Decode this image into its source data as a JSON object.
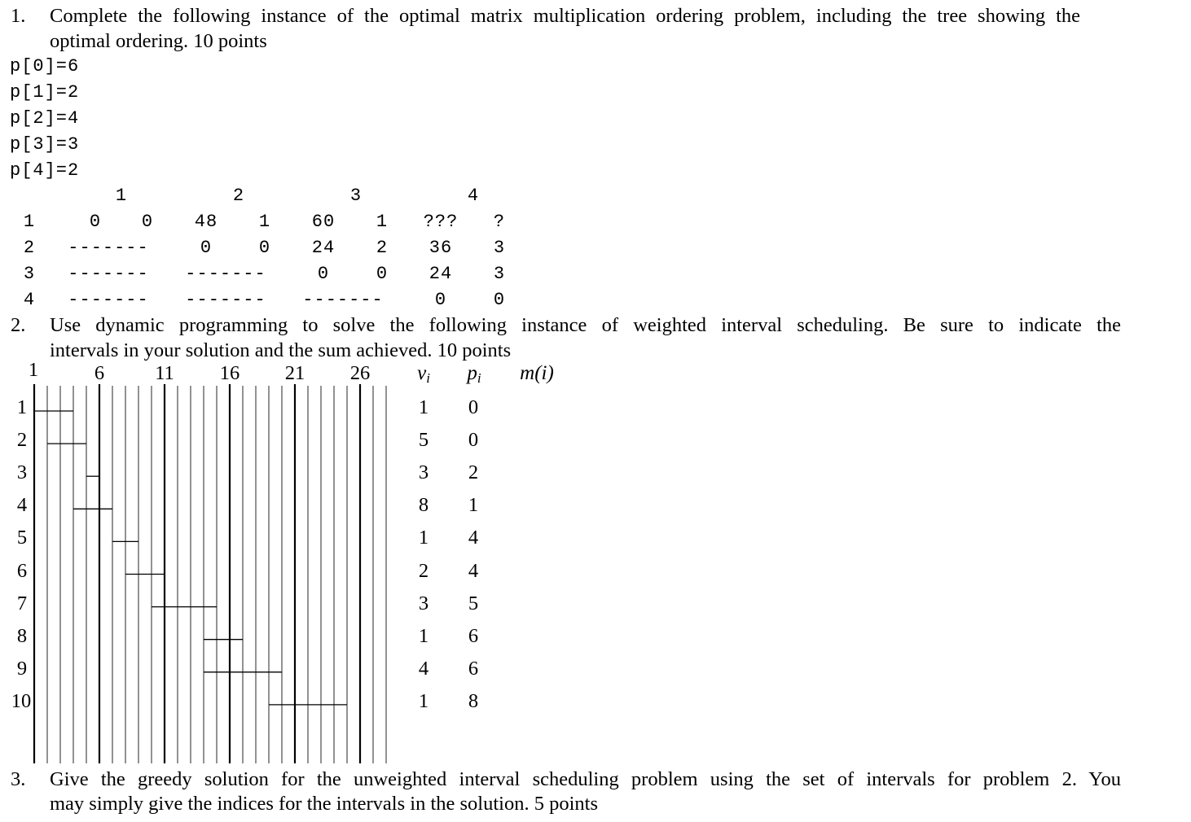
{
  "problem1": {
    "number": "1.",
    "line1": "Complete the following instance of the optimal matrix multiplication ordering problem, including the tree showing the",
    "line2": "optimal ordering.  10 points",
    "p_values": [
      "p[0]=6",
      "p[1]=2",
      "p[2]=4",
      "p[3]=3",
      "p[4]=2"
    ],
    "table": {
      "column_headers": [
        "1",
        "2",
        "3",
        "4"
      ],
      "row_labels": [
        "1",
        "2",
        "3",
        "4"
      ],
      "rows": [
        [
          "0",
          "0",
          "48",
          "1",
          "60",
          "1",
          "???",
          "?"
        ],
        [
          "-------",
          "0",
          "0",
          "24",
          "2",
          "36",
          "3"
        ],
        [
          "-------",
          "-------",
          "0",
          "0",
          "24",
          "3"
        ],
        [
          "-------",
          "-------",
          "-------",
          "0",
          "0"
        ]
      ]
    }
  },
  "problem2": {
    "number": "2.",
    "line1": "Use dynamic programming to solve the following instance of weighted interval scheduling.  Be sure to indicate the",
    "line2": "intervals in your solution and the sum achieved.  10 points",
    "axis_labels": [
      "1",
      "6",
      "11",
      "16",
      "21",
      "26"
    ],
    "axis_range": [
      1,
      28
    ],
    "headers": {
      "v": "v",
      "v_sub": "i",
      "p": "p",
      "p_sub": "i",
      "m": "m(i)"
    },
    "intervals": [
      {
        "id": "1",
        "start": 1,
        "end": 4,
        "v": "1",
        "p": "0"
      },
      {
        "id": "2",
        "start": 2,
        "end": 5,
        "v": "5",
        "p": "0"
      },
      {
        "id": "3",
        "start": 5,
        "end": 6,
        "v": "3",
        "p": "2"
      },
      {
        "id": "4",
        "start": 4,
        "end": 7,
        "v": "8",
        "p": "1"
      },
      {
        "id": "5",
        "start": 7,
        "end": 9,
        "v": "1",
        "p": "4"
      },
      {
        "id": "6",
        "start": 8,
        "end": 11,
        "v": "2",
        "p": "4"
      },
      {
        "id": "7",
        "start": 10,
        "end": 15,
        "v": "3",
        "p": "5"
      },
      {
        "id": "8",
        "start": 14,
        "end": 17,
        "v": "1",
        "p": "6"
      },
      {
        "id": "9",
        "start": 14,
        "end": 20,
        "v": "4",
        "p": "6"
      },
      {
        "id": "10",
        "start": 19,
        "end": 25,
        "v": "1",
        "p": "8"
      }
    ]
  },
  "problem3": {
    "number": "3.",
    "line1": "Give the greedy solution for the unweighted interval scheduling problem using the set of intervals for problem 2.  You",
    "line2": "may simply give the indices for the intervals in the solution.  5 points"
  }
}
